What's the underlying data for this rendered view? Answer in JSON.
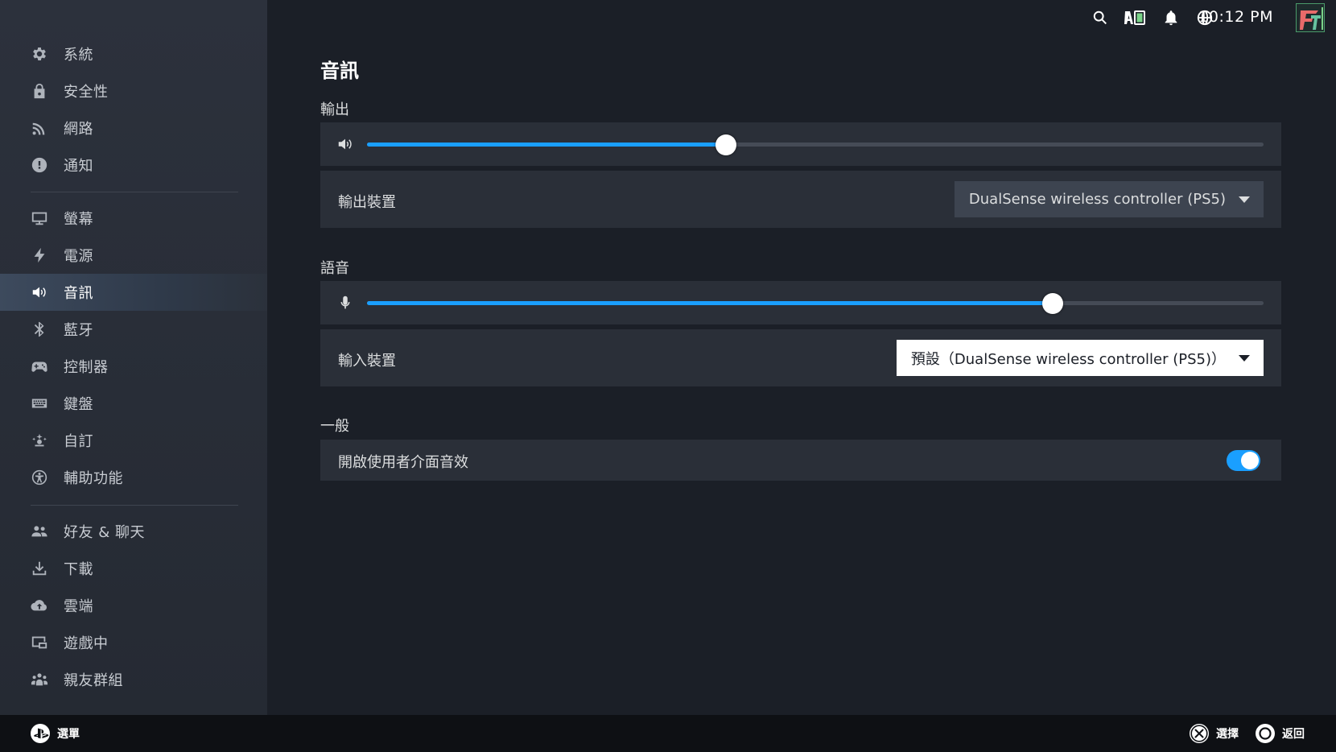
{
  "sidebar": {
    "items": [
      {
        "label": "系統",
        "icon": "gear-icon"
      },
      {
        "label": "安全性",
        "icon": "lock-icon"
      },
      {
        "label": "網路",
        "icon": "wifi-icon"
      },
      {
        "label": "通知",
        "icon": "alert-icon"
      },
      {
        "label": "螢幕",
        "icon": "monitor-icon"
      },
      {
        "label": "電源",
        "icon": "lightning-icon"
      },
      {
        "label": "音訊",
        "icon": "speaker-icon",
        "active": true
      },
      {
        "label": "藍牙",
        "icon": "bluetooth-icon"
      },
      {
        "label": "控制器",
        "icon": "gamepad-icon"
      },
      {
        "label": "鍵盤",
        "icon": "keyboard-icon"
      },
      {
        "label": "自訂",
        "icon": "sparkle-icon"
      },
      {
        "label": "輔助功能",
        "icon": "accessibility-icon"
      },
      {
        "label": "好友 & 聊天",
        "icon": "friends-icon"
      },
      {
        "label": "下載",
        "icon": "download-icon"
      },
      {
        "label": "雲端",
        "icon": "cloud-icon"
      },
      {
        "label": "遊戲中",
        "icon": "in-game-icon"
      },
      {
        "label": "親友群組",
        "icon": "family-icon"
      }
    ]
  },
  "topbar": {
    "time": "10:12 PM",
    "icons": [
      "search-icon",
      "battery-icon",
      "bell-icon",
      "globe-icon"
    ],
    "avatar": "user-avatar"
  },
  "main": {
    "title": "音訊",
    "output": {
      "section_label": "輸出",
      "volume_level": 0.4,
      "device_label": "輸出裝置",
      "device_value": "DualSense wireless controller (PS5)"
    },
    "voice": {
      "section_label": "語音",
      "volume_level": 0.765,
      "device_label": "輸入裝置",
      "device_value": "預設（DualSense wireless controller (PS5)）"
    },
    "general": {
      "section_label": "一般",
      "ui_sounds_label": "開啟使用者介面音效",
      "ui_sounds_enabled": true
    }
  },
  "footer": {
    "menu_label": "選單",
    "select_label": "選擇",
    "back_label": "返回"
  },
  "colors": {
    "accent": "#1a9fff",
    "background": "#1b1f27",
    "panel": "#2a2f38",
    "sidebar": "#2b303a",
    "footer": "#0e1014"
  }
}
